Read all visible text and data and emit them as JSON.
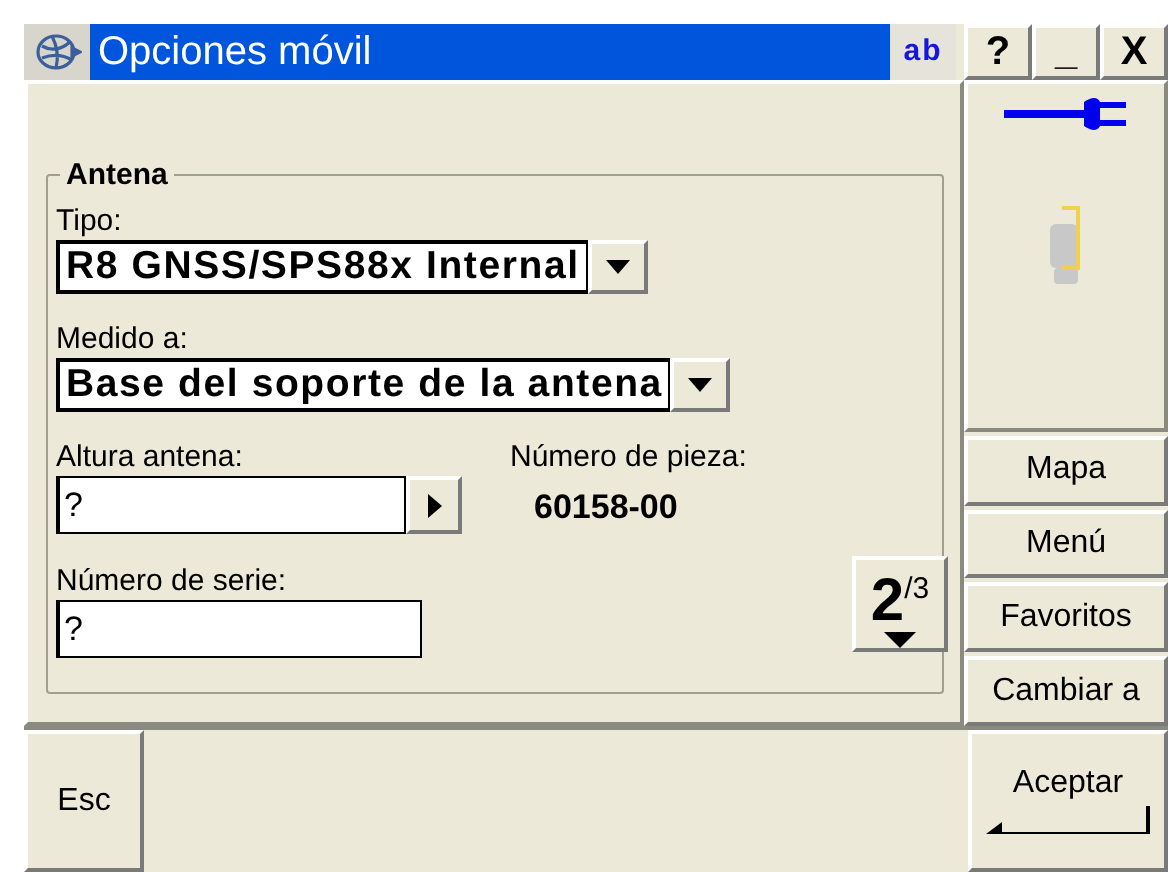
{
  "window": {
    "title": "Opciones móvil",
    "input_mode": "ab"
  },
  "title_buttons": [
    {
      "label": "?"
    },
    {
      "label": "_"
    },
    {
      "label": "X"
    }
  ],
  "group": {
    "title": "Antena",
    "tipo": {
      "label": "Tipo:",
      "value": "R8 GNSS/SPS88x Internal"
    },
    "medido": {
      "label": "Medido a:",
      "value": "Base del soporte de la antena"
    },
    "altura": {
      "label": "Altura antena:",
      "value": "?"
    },
    "pieza": {
      "label": "Número de pieza:",
      "value": "60158-00"
    },
    "serie": {
      "label": "Número de serie:",
      "value": "?"
    }
  },
  "page_indicator": {
    "current": "2",
    "total": "/3"
  },
  "side_buttons": [
    "Mapa",
    "Menú",
    "Favoritos",
    "Cambiar a"
  ],
  "footer": {
    "left": "Esc",
    "right": "Aceptar"
  }
}
